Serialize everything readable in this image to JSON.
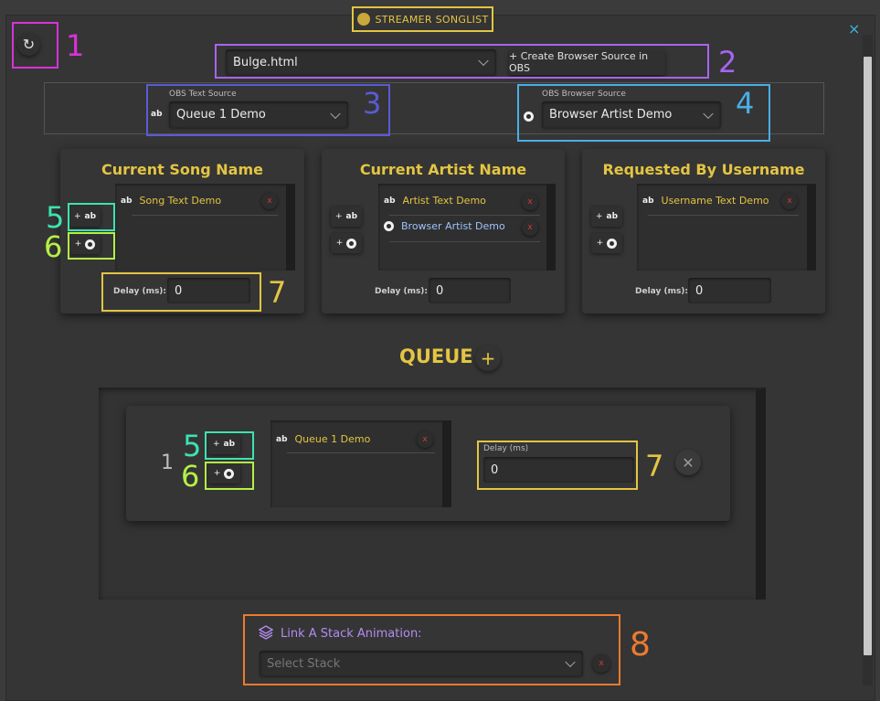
{
  "app": {
    "title": "STREAMER SONGLIST",
    "close_label": "×",
    "refresh_label": "↻"
  },
  "top": {
    "file_select": "Bulge.html",
    "create_source_label": "+ Create Browser Source in OBS"
  },
  "obs": {
    "text_source_label": "OBS Text Source",
    "text_source_value": "Queue 1 Demo",
    "browser_source_label": "OBS Browser Source",
    "browser_source_value": "Browser Artist Demo"
  },
  "cards": [
    {
      "title": "Current Song Name",
      "items": [
        {
          "type": "text",
          "label": "Song Text Demo"
        }
      ],
      "delay_label": "Delay (ms):",
      "delay_value": "0"
    },
    {
      "title": "Current Artist Name",
      "items": [
        {
          "type": "text",
          "label": "Artist Text Demo"
        },
        {
          "type": "browser",
          "label": "Browser Artist Demo"
        }
      ],
      "delay_label": "Delay (ms):",
      "delay_value": "0"
    },
    {
      "title": "Requested By Username",
      "items": [
        {
          "type": "text",
          "label": "Username Text Demo"
        }
      ],
      "delay_label": "Delay (ms):",
      "delay_value": "0"
    }
  ],
  "buttons": {
    "add_text_label": "+",
    "add_browser_label": "+",
    "ab_glyph": "ab",
    "remove_label": "x"
  },
  "queue": {
    "title": "QUEUE",
    "add_label": "+",
    "entries": [
      {
        "index": "1",
        "items": [
          {
            "type": "text",
            "label": "Queue 1 Demo"
          }
        ],
        "delay_label": "Delay (ms)",
        "delay_value": "0",
        "remove_label": "✕"
      }
    ]
  },
  "stack": {
    "label": "Link A Stack Animation:",
    "placeholder": "Select Stack",
    "remove_label": "x"
  },
  "annotations": [
    "1",
    "2",
    "3",
    "4",
    "5",
    "6",
    "7",
    "8",
    "5",
    "6",
    "7"
  ],
  "colors": {
    "accent": "#e3c542",
    "annot_1": "#d832d8",
    "annot_2": "#a864f0",
    "annot_3": "#5a5ad8",
    "annot_4": "#4aaee6",
    "annot_5": "#3ce3b0",
    "annot_6": "#b4f046",
    "annot_7": "#e3c542",
    "annot_8": "#ee7a2e"
  }
}
